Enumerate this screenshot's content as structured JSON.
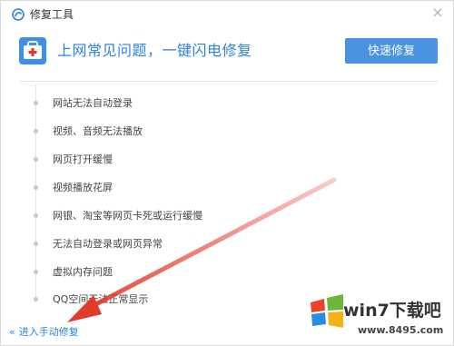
{
  "window": {
    "title": "修复工具",
    "close_glyph": "×"
  },
  "hero": {
    "icon": "first-aid-toolbox-icon",
    "title": "上网常见问题，一键闪电修复",
    "quick_fix_label": "快速修复"
  },
  "issues": [
    {
      "label": "网站无法自动登录"
    },
    {
      "label": "视频、音频无法播放"
    },
    {
      "label": "网页打开缓慢"
    },
    {
      "label": "视频播放花屏"
    },
    {
      "label": "网银、淘宝等网页卡死或运行缓慢"
    },
    {
      "label": "无法自动登录或网页异常"
    },
    {
      "label": "虚拟内存问题"
    },
    {
      "label": "QQ空间无法正常显示"
    }
  ],
  "footer": {
    "chevron": "«",
    "manual_link_label": "进入手动修复"
  },
  "watermark": {
    "brand": "win7下载吧",
    "url": "www.8495.com"
  },
  "colors": {
    "accent_blue": "#2d82e0",
    "button_blue": "#4a92e2",
    "toolbox_blue": "#3f8fe6",
    "annotation_red": "#e23b2e"
  }
}
